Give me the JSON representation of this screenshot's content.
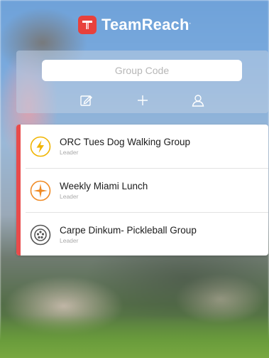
{
  "brand": {
    "name": "TeamReach",
    "trademark": ".",
    "logo_color": "#e8413c",
    "logo_icon": "teamreach-logo-icon"
  },
  "join": {
    "group_code_placeholder": "Group Code",
    "icons": [
      "compose-icon",
      "plus-icon",
      "person-icon"
    ]
  },
  "groups": [
    {
      "name": "ORC Tues Dog Walking Group",
      "role": "Leader",
      "icon": "lightning-icon",
      "icon_color": "#f0b400"
    },
    {
      "name": "Weekly Miami Lunch",
      "role": "Leader",
      "icon": "compass-star-icon",
      "icon_color": "#f08a24"
    },
    {
      "name": "Carpe Dinkum- Pickleball Group",
      "role": "Leader",
      "icon": "ball-icon",
      "icon_color": "#555555"
    }
  ],
  "accent_color": "#e94b4b"
}
